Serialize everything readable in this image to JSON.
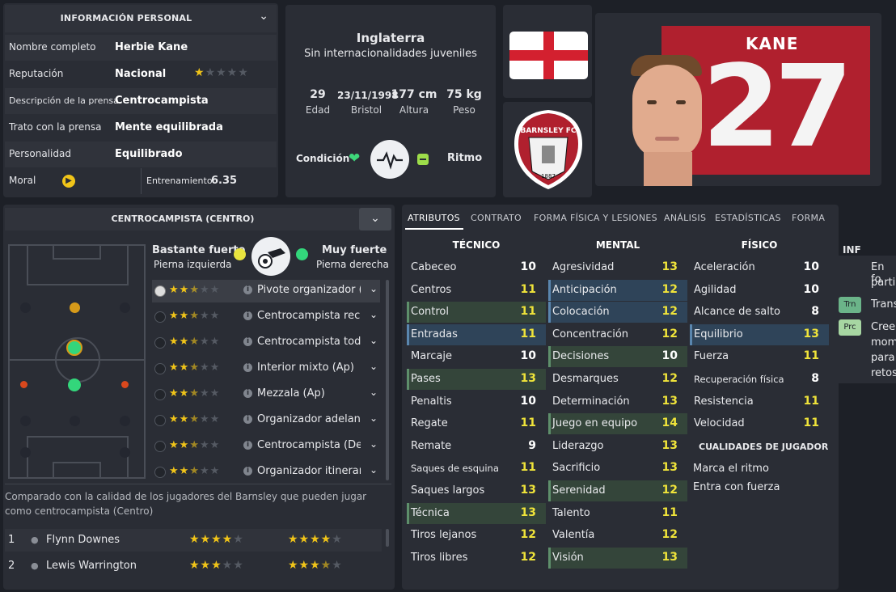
{
  "personal": {
    "header": "INFORMACIÓN PERSONAL",
    "rows": [
      {
        "label": "Nombre completo",
        "value": "Herbie Kane"
      },
      {
        "label": "Reputación",
        "value": "Nacional",
        "stars": 1
      },
      {
        "label": "Descripción de la prensa",
        "value": "Centrocampista"
      },
      {
        "label": "Trato con la prensa",
        "value": "Mente equilibrada"
      },
      {
        "label": "Personalidad",
        "value": "Equilibrado"
      }
    ],
    "morale_label": "Moral",
    "training_label": "Entrenamiento",
    "training_value": "6.35"
  },
  "bio": {
    "country": "Inglaterra",
    "caps": "Sin internacionalidades juveniles",
    "stats": [
      {
        "value": "29",
        "label": "Edad"
      },
      {
        "value": "23/11/1998",
        "label": "Bristol"
      },
      {
        "value": "177 cm",
        "label": "Altura"
      },
      {
        "value": "75 kg",
        "label": "Peso"
      }
    ],
    "condition_label": "Condición",
    "rhythm_label": "Ritmo"
  },
  "club": {
    "badge_top": "BARNSLEY FC",
    "badge_year": "1887"
  },
  "player": {
    "surname": "KANE",
    "number": "27"
  },
  "position": {
    "header": "CENTROCAMPISTA (CENTRO)",
    "left_foot_strength": "Bastante fuerte",
    "left_foot_label": "Pierna izquierda",
    "right_foot_strength": "Muy fuerte",
    "right_foot_label": "Pierna derecha",
    "roles": [
      {
        "name": "Pivote organizador (...",
        "stars": 2.5
      },
      {
        "name": "Centrocampista rec...",
        "stars": 2.5
      },
      {
        "name": "Centrocampista tod...",
        "stars": 2.5
      },
      {
        "name": "Interior mixto (Ap)",
        "stars": 2.5
      },
      {
        "name": "Mezzala (Ap)",
        "stars": 2.5
      },
      {
        "name": "Organizador adelant...",
        "stars": 2.5
      },
      {
        "name": "Centrocampista (De)",
        "stars": 2.5
      },
      {
        "name": "Organizador itineran...",
        "stars": 2.5
      }
    ],
    "comparison_text": "Comparado con la calidad de los jugadores del Barnsley que pueden jugar como centrocampista (Centro)",
    "comparison": [
      {
        "rank": "1",
        "name": "Flynn Downes",
        "current": 4,
        "potential": 4
      },
      {
        "rank": "2",
        "name": "Lewis Warrington",
        "current": 3,
        "potential": 3.5
      }
    ]
  },
  "tabs": [
    "ATRIBUTOS",
    "CONTRATO",
    "FORMA FÍSICA Y LESIONES",
    "ANÁLISIS",
    "ESTADÍSTICAS",
    "FORMA"
  ],
  "attributes": {
    "technical_header": "TÉCNICO",
    "mental_header": "MENTAL",
    "physical_header": "FÍSICO",
    "technical": [
      {
        "name": "Cabeceo",
        "value": "10"
      },
      {
        "name": "Centros",
        "value": "11"
      },
      {
        "name": "Control",
        "value": "11"
      },
      {
        "name": "Entradas",
        "value": "11"
      },
      {
        "name": "Marcaje",
        "value": "10"
      },
      {
        "name": "Pases",
        "value": "13"
      },
      {
        "name": "Penaltis",
        "value": "10"
      },
      {
        "name": "Regate",
        "value": "11"
      },
      {
        "name": "Remate",
        "value": "9"
      },
      {
        "name": "Saques de esquina",
        "value": "11"
      },
      {
        "name": "Saques largos",
        "value": "13"
      },
      {
        "name": "Técnica",
        "value": "13"
      },
      {
        "name": "Tiros lejanos",
        "value": "12"
      },
      {
        "name": "Tiros libres",
        "value": "12"
      }
    ],
    "mental": [
      {
        "name": "Agresividad",
        "value": "13"
      },
      {
        "name": "Anticipación",
        "value": "12"
      },
      {
        "name": "Colocación",
        "value": "12"
      },
      {
        "name": "Concentración",
        "value": "12"
      },
      {
        "name": "Decisiones",
        "value": "10"
      },
      {
        "name": "Desmarques",
        "value": "12"
      },
      {
        "name": "Determinación",
        "value": "13"
      },
      {
        "name": "Juego en equipo",
        "value": "14"
      },
      {
        "name": "Liderazgo",
        "value": "13"
      },
      {
        "name": "Sacrificio",
        "value": "13"
      },
      {
        "name": "Serenidad",
        "value": "12"
      },
      {
        "name": "Talento",
        "value": "11"
      },
      {
        "name": "Valentía",
        "value": "12"
      },
      {
        "name": "Visión",
        "value": "13"
      }
    ],
    "physical": [
      {
        "name": "Aceleración",
        "value": "10"
      },
      {
        "name": "Agilidad",
        "value": "10"
      },
      {
        "name": "Alcance de salto",
        "value": "8"
      },
      {
        "name": "Equilibrio",
        "value": "13"
      },
      {
        "name": "Fuerza",
        "value": "11"
      },
      {
        "name": "Recuperación física",
        "value": "8"
      },
      {
        "name": "Resistencia",
        "value": "11"
      },
      {
        "name": "Velocidad",
        "value": "11"
      }
    ],
    "traits_header": "CUALIDADES DE JUGADOR",
    "traits": [
      "Marca el ritmo",
      "Entra con fuerza"
    ]
  },
  "info": {
    "header": "INF",
    "lines": [
      "En fo",
      "partic"
    ],
    "items": [
      {
        "badge": "Trn",
        "text": "Trans"
      },
      {
        "badge": "Prc",
        "text": "Cree",
        "more": [
          "mom",
          "para",
          "retos"
        ]
      }
    ]
  },
  "colors": {
    "green": "#5e8f6b",
    "blue": "#5a86ae",
    "yellow": "#f0e43a",
    "club_red": "#b0202e"
  }
}
